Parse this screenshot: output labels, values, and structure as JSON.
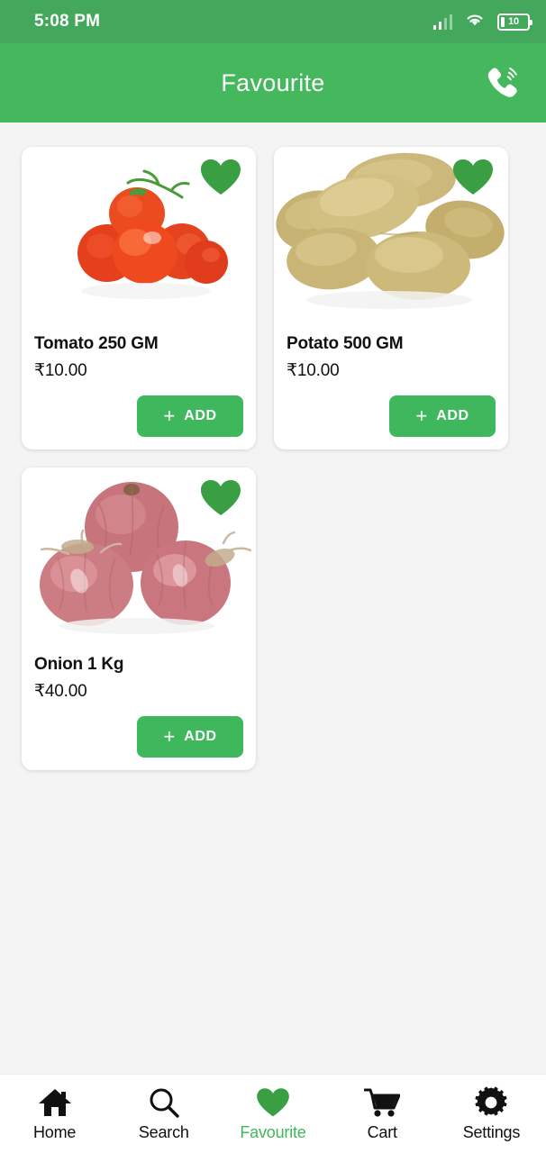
{
  "statusbar": {
    "time": "5:08 PM",
    "battery_level": "10",
    "signal_icon": "signal-bars-icon",
    "wifi_icon": "wifi-icon",
    "battery_icon": "battery-icon"
  },
  "appbar": {
    "title": "Favourite",
    "call_icon": "phone-call-icon",
    "background_color": "#45b75c"
  },
  "theme": {
    "accent_green": "#3fb75d",
    "appbar_green": "#45b75c",
    "statusbar_green": "#43a85c",
    "page_background": "#f4f4f4"
  },
  "products": [
    {
      "name": "Tomato 250 GM",
      "price": "₹10.00",
      "image": "tomato-image",
      "favourite_icon": "heart-filled-icon",
      "favourite": true,
      "add_label": "ADD",
      "add_plus": "+"
    },
    {
      "name": "Potato 500 GM",
      "price": "₹10.00",
      "image": "potato-image",
      "favourite_icon": "heart-filled-icon",
      "favourite": true,
      "add_label": "ADD",
      "add_plus": "+"
    },
    {
      "name": "Onion 1 Kg",
      "price": "₹40.00",
      "image": "onion-image",
      "favourite_icon": "heart-filled-icon",
      "favourite": true,
      "add_label": "ADD",
      "add_plus": "+"
    }
  ],
  "bottomnav": {
    "items": [
      {
        "label": "Home",
        "icon": "home-icon",
        "active": false
      },
      {
        "label": "Search",
        "icon": "search-icon",
        "active": false
      },
      {
        "label": "Favourite",
        "icon": "heart-icon",
        "active": true
      },
      {
        "label": "Cart",
        "icon": "cart-icon",
        "active": false
      },
      {
        "label": "Settings",
        "icon": "gear-icon",
        "active": false
      }
    ]
  }
}
